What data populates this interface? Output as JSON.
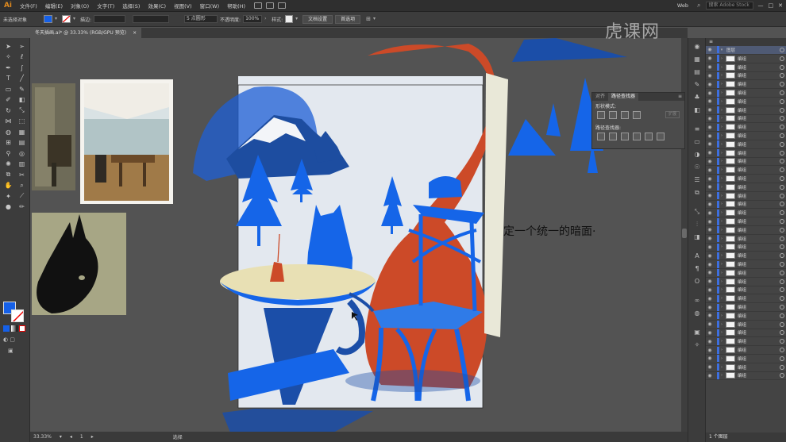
{
  "app": {
    "logo": "Ai",
    "workspace": "Web"
  },
  "menu": [
    "文件(F)",
    "编辑(E)",
    "对象(O)",
    "文字(T)",
    "选择(S)",
    "效果(C)",
    "视图(V)",
    "窗口(W)",
    "帮助(H)"
  ],
  "search": {
    "placeholder": "搜索 Adobe Stock"
  },
  "control": {
    "selection_label": "未选择对象",
    "stroke_label": "描边:",
    "point_label": "5 点圆形",
    "opacity_label": "不透明度:",
    "opacity_value": "100%",
    "style_label": "样式:",
    "doc_setup": "文档设置",
    "prefs": "首选项"
  },
  "document_tab": {
    "name": "冬天插画.ai* @ 33.33% (RGB/GPU 预览)",
    "close": "×"
  },
  "status": {
    "zoom": "33.33%",
    "page": "1",
    "tool": "选择"
  },
  "pathfinder": {
    "tab_transform": "对齐",
    "tab_pathfinder": "路径查找器",
    "shape_modes": "形状模式:",
    "pathfinders": "路径查找器:",
    "expand": "扩展"
  },
  "watermark": "虎课网",
  "subtitle": "定一个统一的暗面·",
  "layers": {
    "top_layer": "图层",
    "rows": [
      "编组",
      "编组",
      "编组",
      "编组",
      "编组",
      "编组",
      "编组",
      "编组",
      "编组",
      "编组",
      "编组",
      "编组",
      "编组",
      "编组",
      "编组",
      "编组",
      "编组",
      "编组",
      "编组",
      "编组",
      "编组",
      "编组",
      "编组",
      "编组",
      "编组",
      "编组",
      "编组",
      "编组",
      "编组",
      "编组",
      "编组",
      "编组",
      "编组",
      "编组",
      "编组",
      "编组",
      "编组",
      "编组"
    ],
    "footer": "1 个图层"
  },
  "colors": {
    "blue": "#1560e8",
    "orange": "#cc4a28",
    "paper": "#e3e8ef",
    "dark_blue": "#1b4ea8",
    "cream": "#e8e0b4"
  }
}
